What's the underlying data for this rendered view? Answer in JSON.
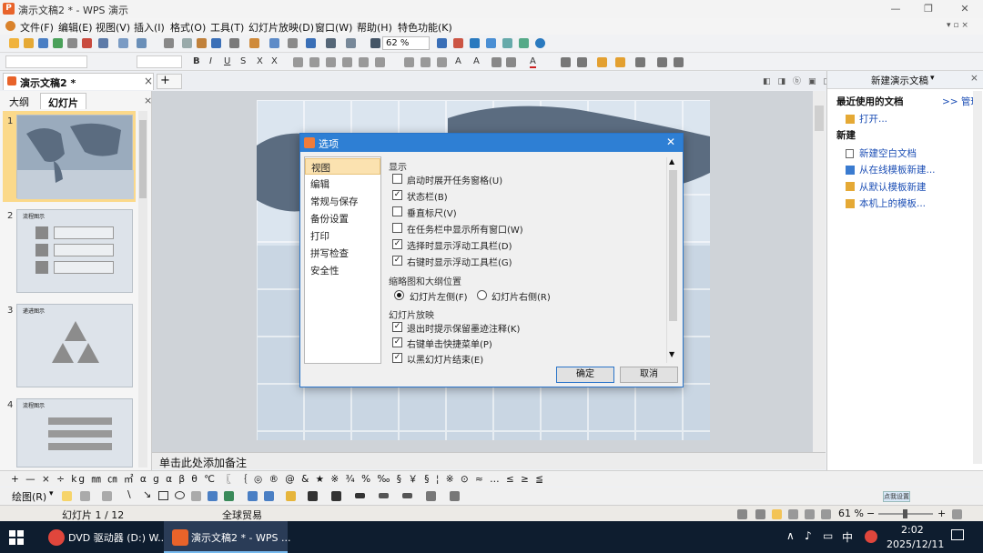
{
  "window": {
    "title": "演示文稿2 * - WPS 演示",
    "logo": "P"
  },
  "menu": [
    "文件(F)",
    "编辑(E)",
    "视图(V)",
    "插入(I)",
    "格式(O)",
    "工具(T)",
    "幻灯片放映(D)",
    "窗口(W)",
    "帮助(H)",
    "特色功能(K)"
  ],
  "toolbar": {
    "zoom": "62 %"
  },
  "doc_tab": {
    "title": "演示文稿2 *",
    "close": "×",
    "add": "+"
  },
  "left_panel": {
    "tabs": [
      "大纲",
      "幻灯片"
    ],
    "thumb_titles": [
      "",
      "流程图示",
      "递进图示",
      "流程图示"
    ],
    "numbers": [
      "1",
      "2",
      "3",
      "4"
    ]
  },
  "notes": {
    "placeholder": "单击此处添加备注"
  },
  "task_pane": {
    "title": "新建演示文稿",
    "recent_header": "最近使用的文档",
    "manage": ">> 管理",
    "open": "打开...",
    "new_header": "新建",
    "items": [
      "新建空白文档",
      "从在线模板新建...",
      "从默认模板新建",
      "本机上的模板..."
    ]
  },
  "dialog": {
    "title": "选项",
    "close": "✕",
    "nav": [
      "视图",
      "编辑",
      "常规与保存",
      "备份设置",
      "打印",
      "拼写检查",
      "安全性"
    ],
    "selected": "视图",
    "group_display": "显示",
    "display_options": [
      {
        "label": "启动时展开任务窗格(U)",
        "checked": false
      },
      {
        "label": "状态栏(B)",
        "checked": true
      },
      {
        "label": "垂直标尺(V)",
        "checked": false
      },
      {
        "label": "在任务栏中显示所有窗口(W)",
        "checked": false
      },
      {
        "label": "选择时显示浮动工具栏(D)",
        "checked": true
      },
      {
        "label": "右键时显示浮动工具栏(G)",
        "checked": true
      }
    ],
    "group_thumb": "缩略图和大纲位置",
    "radio": [
      {
        "label": "幻灯片左侧(F)",
        "selected": true
      },
      {
        "label": "幻灯片右侧(R)",
        "selected": false
      }
    ],
    "group_show": "幻灯片放映",
    "show_options": [
      {
        "label": "退出时提示保留墨迹注释(K)",
        "checked": true
      },
      {
        "label": "右键单击快捷菜单(P)",
        "checked": true
      },
      {
        "label": "以黑幻灯片结束(E)",
        "checked": true
      }
    ],
    "ok": "确定",
    "cancel": "取消"
  },
  "draw_toolbar": {
    "label": "绘图(R)"
  },
  "status": {
    "slide": "幻灯片 1 / 12",
    "template": "全球贸易",
    "zoom": "61 %"
  },
  "taskbar": {
    "apps": [
      "DVD 驱动器 (D:) W...",
      "演示文稿2 * - WPS ..."
    ],
    "time": "2:02",
    "date": "2025/12/11",
    "ime": "中",
    "tray_extra": "点我设置"
  },
  "symbols": "+ — × ÷ kg ㎜ ㎝ ㎡ α g α β θ ℃ 〖 ｛ ◎ ® @ & ★ ※ ¾ % ‰ § ￥ § ¦ ※ ⊙ ≈ … ≤ ≥ ≦ ≧"
}
